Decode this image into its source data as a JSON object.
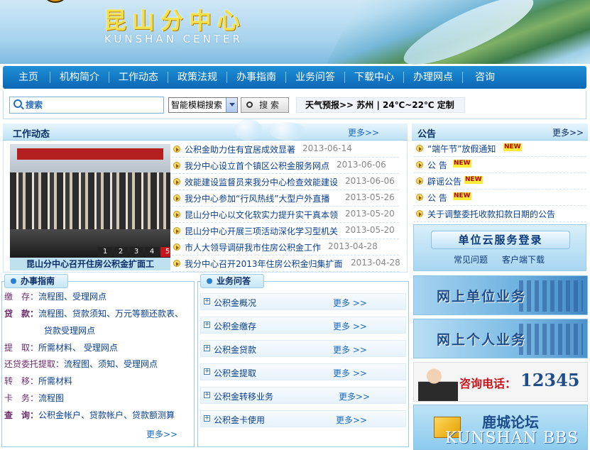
{
  "header": {
    "title_cn": "昆山分中心",
    "title_en": "KUNSHAN CENTER"
  },
  "nav": {
    "items": [
      "主页",
      "机构简介",
      "工作动态",
      "政策法规",
      "办事指南",
      "业务问答",
      "下载中心",
      "办理网点",
      "咨询"
    ]
  },
  "search": {
    "input_value": "搜索",
    "select_value": "智能模糊搜索",
    "button_label": "搜 索",
    "weather": "天气预报>> 苏州 | 24℃~22℃ 定制"
  },
  "news": {
    "title": "工作动态",
    "more": "更多>>",
    "photo_caption": "昆山分中心召开住房公积金扩面工",
    "pager": [
      "1",
      "2",
      "3",
      "4",
      "5"
    ],
    "items": [
      {
        "title": "公积金助力住有宜居成效显著",
        "date": "2013-06-14"
      },
      {
        "title": "我分中心设立首个镇区公积金服务网点",
        "date": "2013-06-06"
      },
      {
        "title": "效能建设监督员来我分中心检查效能建设",
        "date": "2013-06-06"
      },
      {
        "title": "我分中心参加“行风热线”大型户外直播",
        "date": "2013-05-26"
      },
      {
        "title": "昆山分中心以文化软实力提升实干真本领",
        "date": "2013-05-20"
      },
      {
        "title": "昆山分中心开展三项活动深化学习型机关",
        "date": "2013-05-20"
      },
      {
        "title": "市人大领导调研我市住房公积金工作",
        "date": "2013-04-28"
      },
      {
        "title": "我分中心召开2013年住房公积金归集扩面",
        "date": "2013-04-28"
      }
    ]
  },
  "notice": {
    "title": "公告",
    "more": "更多>>",
    "items": [
      {
        "title": "“端午节”放假通知",
        "new": "NEW"
      },
      {
        "title": "公 告",
        "new": "NEW"
      },
      {
        "title": "辟谣公告",
        "new": "NEW"
      },
      {
        "title": "公 告",
        "new": "NEW"
      },
      {
        "title": "关于调整委托收款扣款日期的公告",
        "new": ""
      }
    ]
  },
  "cloud_login": {
    "button": "单位云服务登录",
    "faq": "常见问题",
    "client": "客户端下载"
  },
  "guide": {
    "title": "办事指南",
    "rows": [
      {
        "label": "缴　存：",
        "value": "流程图、受理网点"
      },
      {
        "label": "贷　款：",
        "value": "流程图、贷款须知、万元等额还款表、"
      },
      {
        "label": "",
        "value": "贷款受理网点"
      },
      {
        "label": "提　取：",
        "value": "所需材料、  受理网点"
      },
      {
        "label": "还贷委托提取：",
        "value": "流程图、须知、受理网点"
      },
      {
        "label": "转　移：",
        "value": "所需材料"
      },
      {
        "label": "卡　务：",
        "value": "流程图"
      },
      {
        "label": "查　询：",
        "value": "公积金帐户、贷款帐户、贷款额测算"
      }
    ],
    "more": "更多>>"
  },
  "faq": {
    "title": "业务问答",
    "items": [
      {
        "title": "公积金概况",
        "more": "更多 >>"
      },
      {
        "title": "公积金缴存",
        "more": "更多 >>"
      },
      {
        "title": "公积金贷款",
        "more": "更多 >>"
      },
      {
        "title": "公积金提取",
        "more": "更多 >>"
      },
      {
        "title": "公积金转移业务",
        "more": "更多>>"
      },
      {
        "title": "公积金卡使用",
        "more": "更多>>"
      }
    ]
  },
  "right_banners": {
    "unit_business": "网上单位业务",
    "personal_business": "网上个人业务",
    "hotline_label": "咨询电话：",
    "hotline_number": "12345",
    "bbs_cn": "鹿城论坛",
    "bbs_en": "KUNSHAN BBS"
  }
}
